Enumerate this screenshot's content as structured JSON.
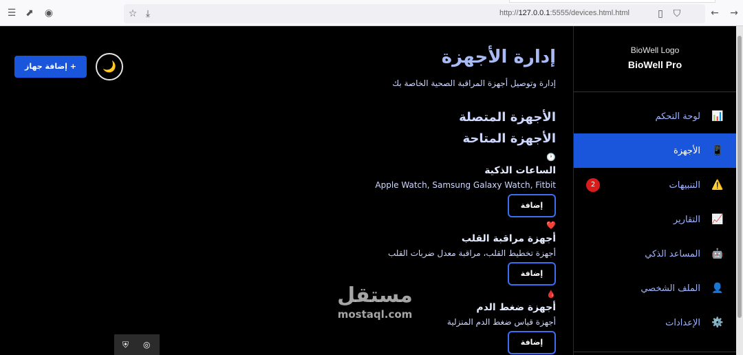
{
  "browser": {
    "url_prefix": "http://",
    "url_host": "127.0.0.1",
    "url_rest": ":5555/devices.html.html"
  },
  "sidebar": {
    "logo_alt": "BioWell Logo",
    "brand": "BioWell Pro",
    "items": [
      {
        "label": "لوحة التحكم",
        "icon": "📊"
      },
      {
        "label": "الأجهزة",
        "icon": "📱"
      },
      {
        "label": "التنبيهات",
        "icon": "⚠️",
        "badge": "2"
      },
      {
        "label": "التقارير",
        "icon": "📈"
      },
      {
        "label": "المساعد الذكي",
        "icon": "🤖"
      },
      {
        "label": "الملف الشخصي",
        "icon": "👤"
      },
      {
        "label": "الإعدادات",
        "icon": "⚙️"
      }
    ]
  },
  "header": {
    "add_device_label": "+ إضافة جهاز",
    "theme_icon": "🌙",
    "title": "إدارة الأجهزة",
    "subtitle": "إدارة وتوصيل أجهزة المراقبة الصحية الخاصة بك"
  },
  "sections": {
    "connected": "الأجهزة المتصلة",
    "available": "الأجهزة المتاحة"
  },
  "devices": [
    {
      "icon": "🕐",
      "name": "الساعات الذكية",
      "desc": "Apple Watch, Samsung Galaxy Watch, Fitbit",
      "button": "إضافة"
    },
    {
      "icon": "❤️",
      "name": "أجهزة مراقبة القلب",
      "desc": "أجهزة تخطيط القلب، مراقبة معدل ضربات القلب",
      "button": "إضافة"
    },
    {
      "icon": "🩸",
      "name": "أجهزة ضغط الدم",
      "desc": "أجهزة قياس ضغط الدم المنزلية",
      "button": "إضافة"
    }
  ],
  "watermark": {
    "arabic": "مستقل",
    "latin": "mostaql.com"
  }
}
